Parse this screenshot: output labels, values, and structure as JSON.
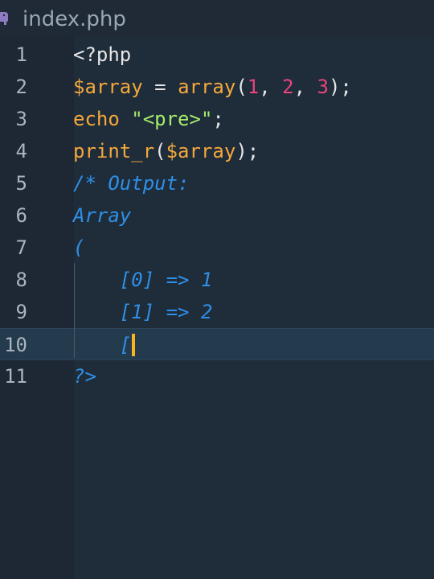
{
  "tab": {
    "icon": "php-elephant-icon",
    "filename": "index.php"
  },
  "editor": {
    "active_line": 10,
    "lines": [
      {
        "number": "1",
        "tokens": [
          {
            "t": "<?php",
            "c": "tag"
          }
        ]
      },
      {
        "number": "2",
        "tokens": [
          {
            "t": "$array",
            "c": "var"
          },
          {
            "t": " = ",
            "c": "op"
          },
          {
            "t": "array",
            "c": "func"
          },
          {
            "t": "(",
            "c": "op"
          },
          {
            "t": "1",
            "c": "num"
          },
          {
            "t": ", ",
            "c": "op"
          },
          {
            "t": "2",
            "c": "num"
          },
          {
            "t": ", ",
            "c": "op"
          },
          {
            "t": "3",
            "c": "num"
          },
          {
            "t": ");",
            "c": "op"
          }
        ]
      },
      {
        "number": "3",
        "tokens": [
          {
            "t": "echo",
            "c": "kw"
          },
          {
            "t": " ",
            "c": "op"
          },
          {
            "t": "\"<pre>\"",
            "c": "str"
          },
          {
            "t": ";",
            "c": "op"
          }
        ]
      },
      {
        "number": "4",
        "tokens": [
          {
            "t": "print_r",
            "c": "func"
          },
          {
            "t": "(",
            "c": "op"
          },
          {
            "t": "$array",
            "c": "var"
          },
          {
            "t": ");",
            "c": "op"
          }
        ]
      },
      {
        "number": "5",
        "tokens": [
          {
            "t": "/* Output:",
            "c": "comment"
          }
        ]
      },
      {
        "number": "6",
        "tokens": [
          {
            "t": "Array",
            "c": "comment"
          }
        ]
      },
      {
        "number": "7",
        "tokens": [
          {
            "t": "(",
            "c": "comment"
          }
        ]
      },
      {
        "number": "8",
        "tokens": [
          {
            "t": "    [0] => 1",
            "c": "comment"
          }
        ]
      },
      {
        "number": "9",
        "tokens": [
          {
            "t": "    [1] => 2",
            "c": "comment"
          }
        ]
      },
      {
        "number": "10",
        "tokens": [
          {
            "t": "    [",
            "c": "comment"
          }
        ],
        "cursor": true
      },
      {
        "number": "11",
        "tokens": [
          {
            "t": "?>",
            "c": "comment"
          }
        ]
      }
    ]
  },
  "colors": {
    "background": "#1d2834",
    "active_line": "#243a4d",
    "cursor": "#f8b61c",
    "variable": "#f4a83c",
    "number": "#e8457b",
    "string": "#a4ec6b",
    "comment": "#2f8fe6"
  }
}
